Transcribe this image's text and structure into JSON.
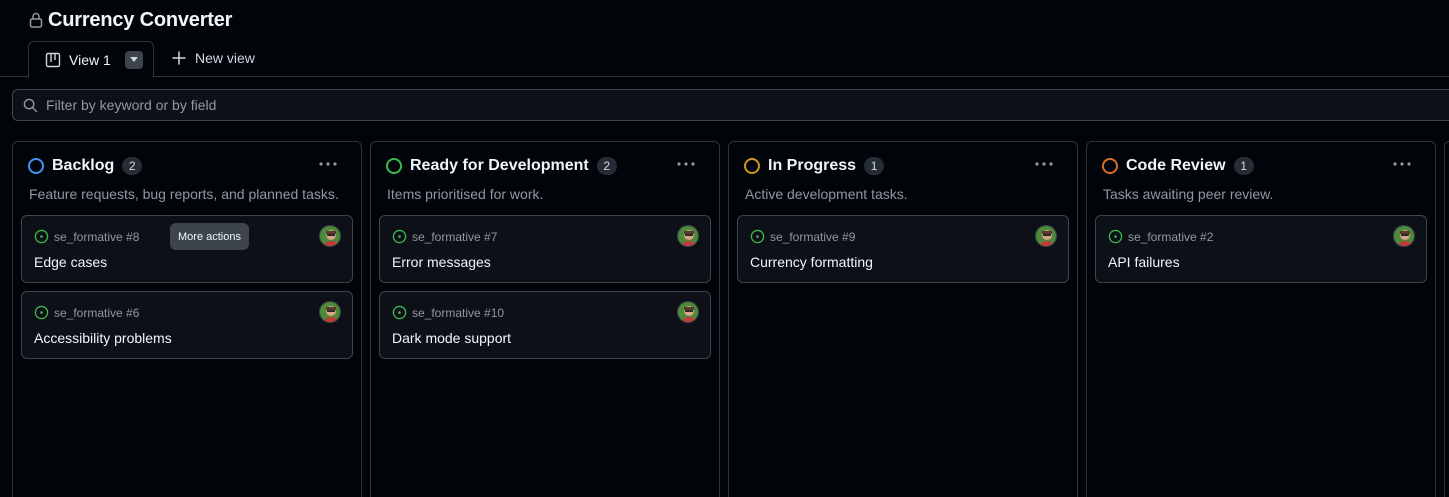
{
  "header": {
    "title": "Currency Converter",
    "lock_icon": "lock-icon"
  },
  "tabs": {
    "active": {
      "label": "View 1",
      "icon": "board-icon",
      "menu_icon": "triangle-down-icon"
    },
    "new_view": {
      "label": "New view",
      "icon": "plus-icon"
    }
  },
  "filter": {
    "placeholder": "Filter by keyword or by field",
    "value": "",
    "icon": "search-icon"
  },
  "tooltip": {
    "text": "More actions"
  },
  "colors": {
    "open_issue": "#3fb950",
    "backlog": "#4493f8",
    "ready": "#3fb950",
    "in_progress": "#d29922",
    "code_review": "#db6d28"
  },
  "columns": [
    {
      "name": "Backlog",
      "count": "2",
      "description": "Feature requests, bug reports, and planned tasks.",
      "cards": [
        {
          "ref": "se_formative #8",
          "title": "Edge cases"
        },
        {
          "ref": "se_formative #6",
          "title": "Accessibility problems"
        }
      ]
    },
    {
      "name": "Ready for Development",
      "count": "2",
      "description": "Items prioritised for work.",
      "cards": [
        {
          "ref": "se_formative #7",
          "title": "Error messages"
        },
        {
          "ref": "se_formative #10",
          "title": "Dark mode support"
        }
      ]
    },
    {
      "name": "In Progress",
      "count": "1",
      "description": "Active development tasks.",
      "cards": [
        {
          "ref": "se_formative #9",
          "title": "Currency formatting"
        }
      ]
    },
    {
      "name": "Code Review",
      "count": "1",
      "description": "Tasks awaiting peer review.",
      "cards": [
        {
          "ref": "se_formative #2",
          "title": "API failures"
        }
      ]
    }
  ]
}
